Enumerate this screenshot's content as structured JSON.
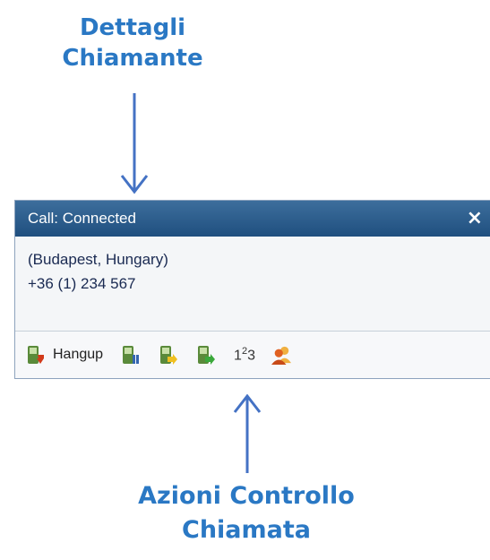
{
  "annotations": {
    "top_line1": "Dettagli",
    "top_line2": "Chiamante",
    "bottom_line1": "Azioni Controllo",
    "bottom_line2": "Chiamata"
  },
  "window": {
    "title": "Call: Connected",
    "close_label": "×"
  },
  "caller": {
    "location": "(Budapest, Hungary)",
    "number": "+36 (1) 234 567"
  },
  "toolbar": {
    "hangup_label": "Hangup",
    "keypad_label_1": "1",
    "keypad_label_2": "2",
    "keypad_label_3": "3"
  },
  "colors": {
    "accent": "#2a78c4",
    "titlebar": "#1f4f7f",
    "caller_text": "#1a2a52"
  }
}
